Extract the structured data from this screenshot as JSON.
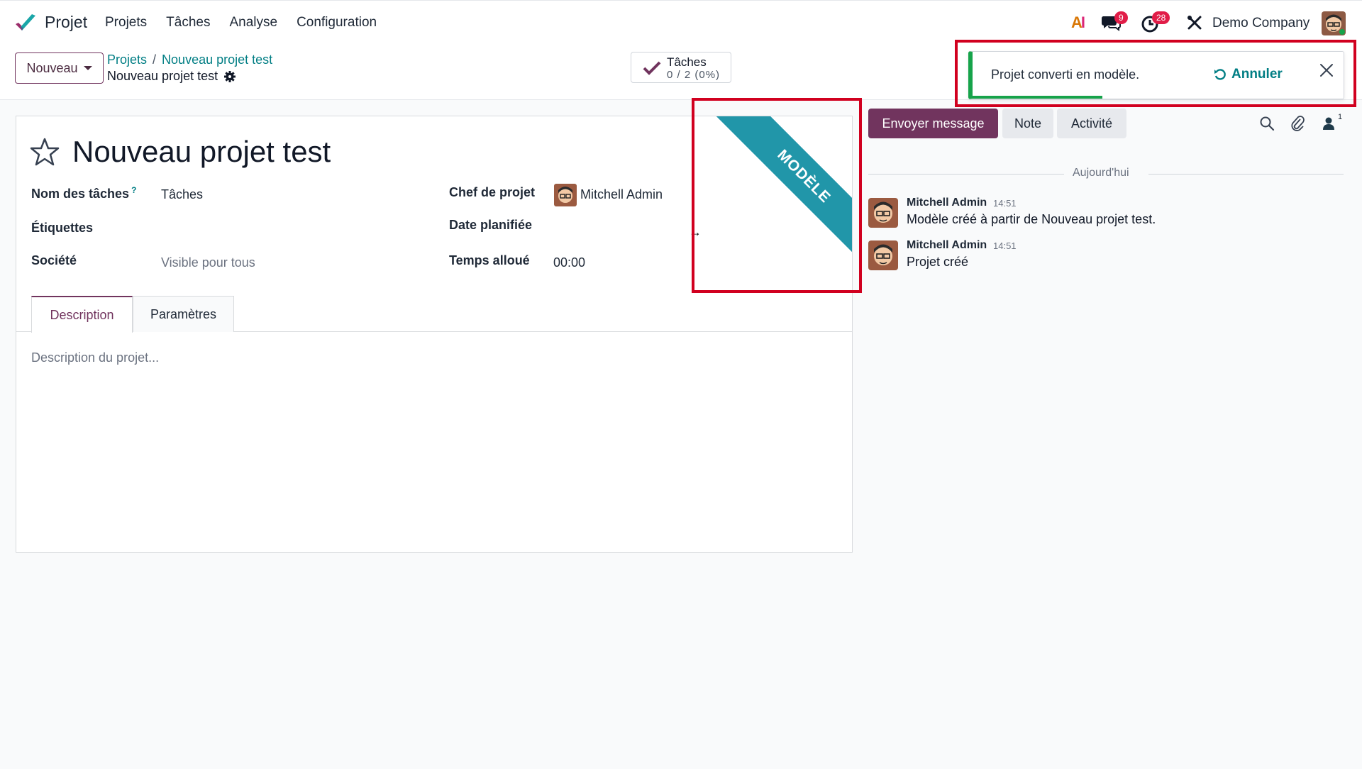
{
  "navbar": {
    "app_name": "Projet",
    "menu": [
      "Projets",
      "Tâches",
      "Analyse",
      "Configuration"
    ],
    "ai_label": "AI",
    "messages_count": "9",
    "activities_count": "28",
    "company": "Demo Company"
  },
  "control": {
    "new_label": "Nouveau",
    "breadcrumb_root": "Projets",
    "breadcrumb_sep": "/",
    "breadcrumb_current": "Nouveau projet test",
    "record_name": "Nouveau projet test",
    "stat_label": "Tâches",
    "stat_value": "0 / 2 (0%)"
  },
  "form": {
    "title": "Nouveau projet test",
    "ribbon": "MODÈLE",
    "fields": {
      "task_name_label": "Nom des tâches",
      "task_name_help": "?",
      "task_name_value": "Tâches",
      "tags_label": "Étiquettes",
      "company_label": "Société",
      "company_placeholder": "Visible pour tous",
      "manager_label": "Chef de projet",
      "manager_value": "Mitchell Admin",
      "date_label": "Date planifiée",
      "time_label": "Temps alloué",
      "time_value": "00:00"
    },
    "tabs": [
      "Description",
      "Paramètres"
    ],
    "description_placeholder": "Description du projet..."
  },
  "chatter": {
    "send_label": "Envoyer message",
    "note_label": "Note",
    "activity_label": "Activité",
    "followers_count": "1",
    "date_separator": "Aujourd'hui",
    "messages": [
      {
        "author": "Mitchell Admin",
        "time": "14:51",
        "body": "Modèle créé à partir de Nouveau projet test."
      },
      {
        "author": "Mitchell Admin",
        "time": "14:51",
        "body": "Projet créé"
      }
    ]
  },
  "notification": {
    "message": "Projet converti en modèle.",
    "undo_label": "Annuler",
    "progress": 0.35
  },
  "colors": {
    "brand": "#71345e",
    "link": "#017e84",
    "ribbon": "#2196a9",
    "success": "#16a34a",
    "highlight": "#d1001f"
  }
}
